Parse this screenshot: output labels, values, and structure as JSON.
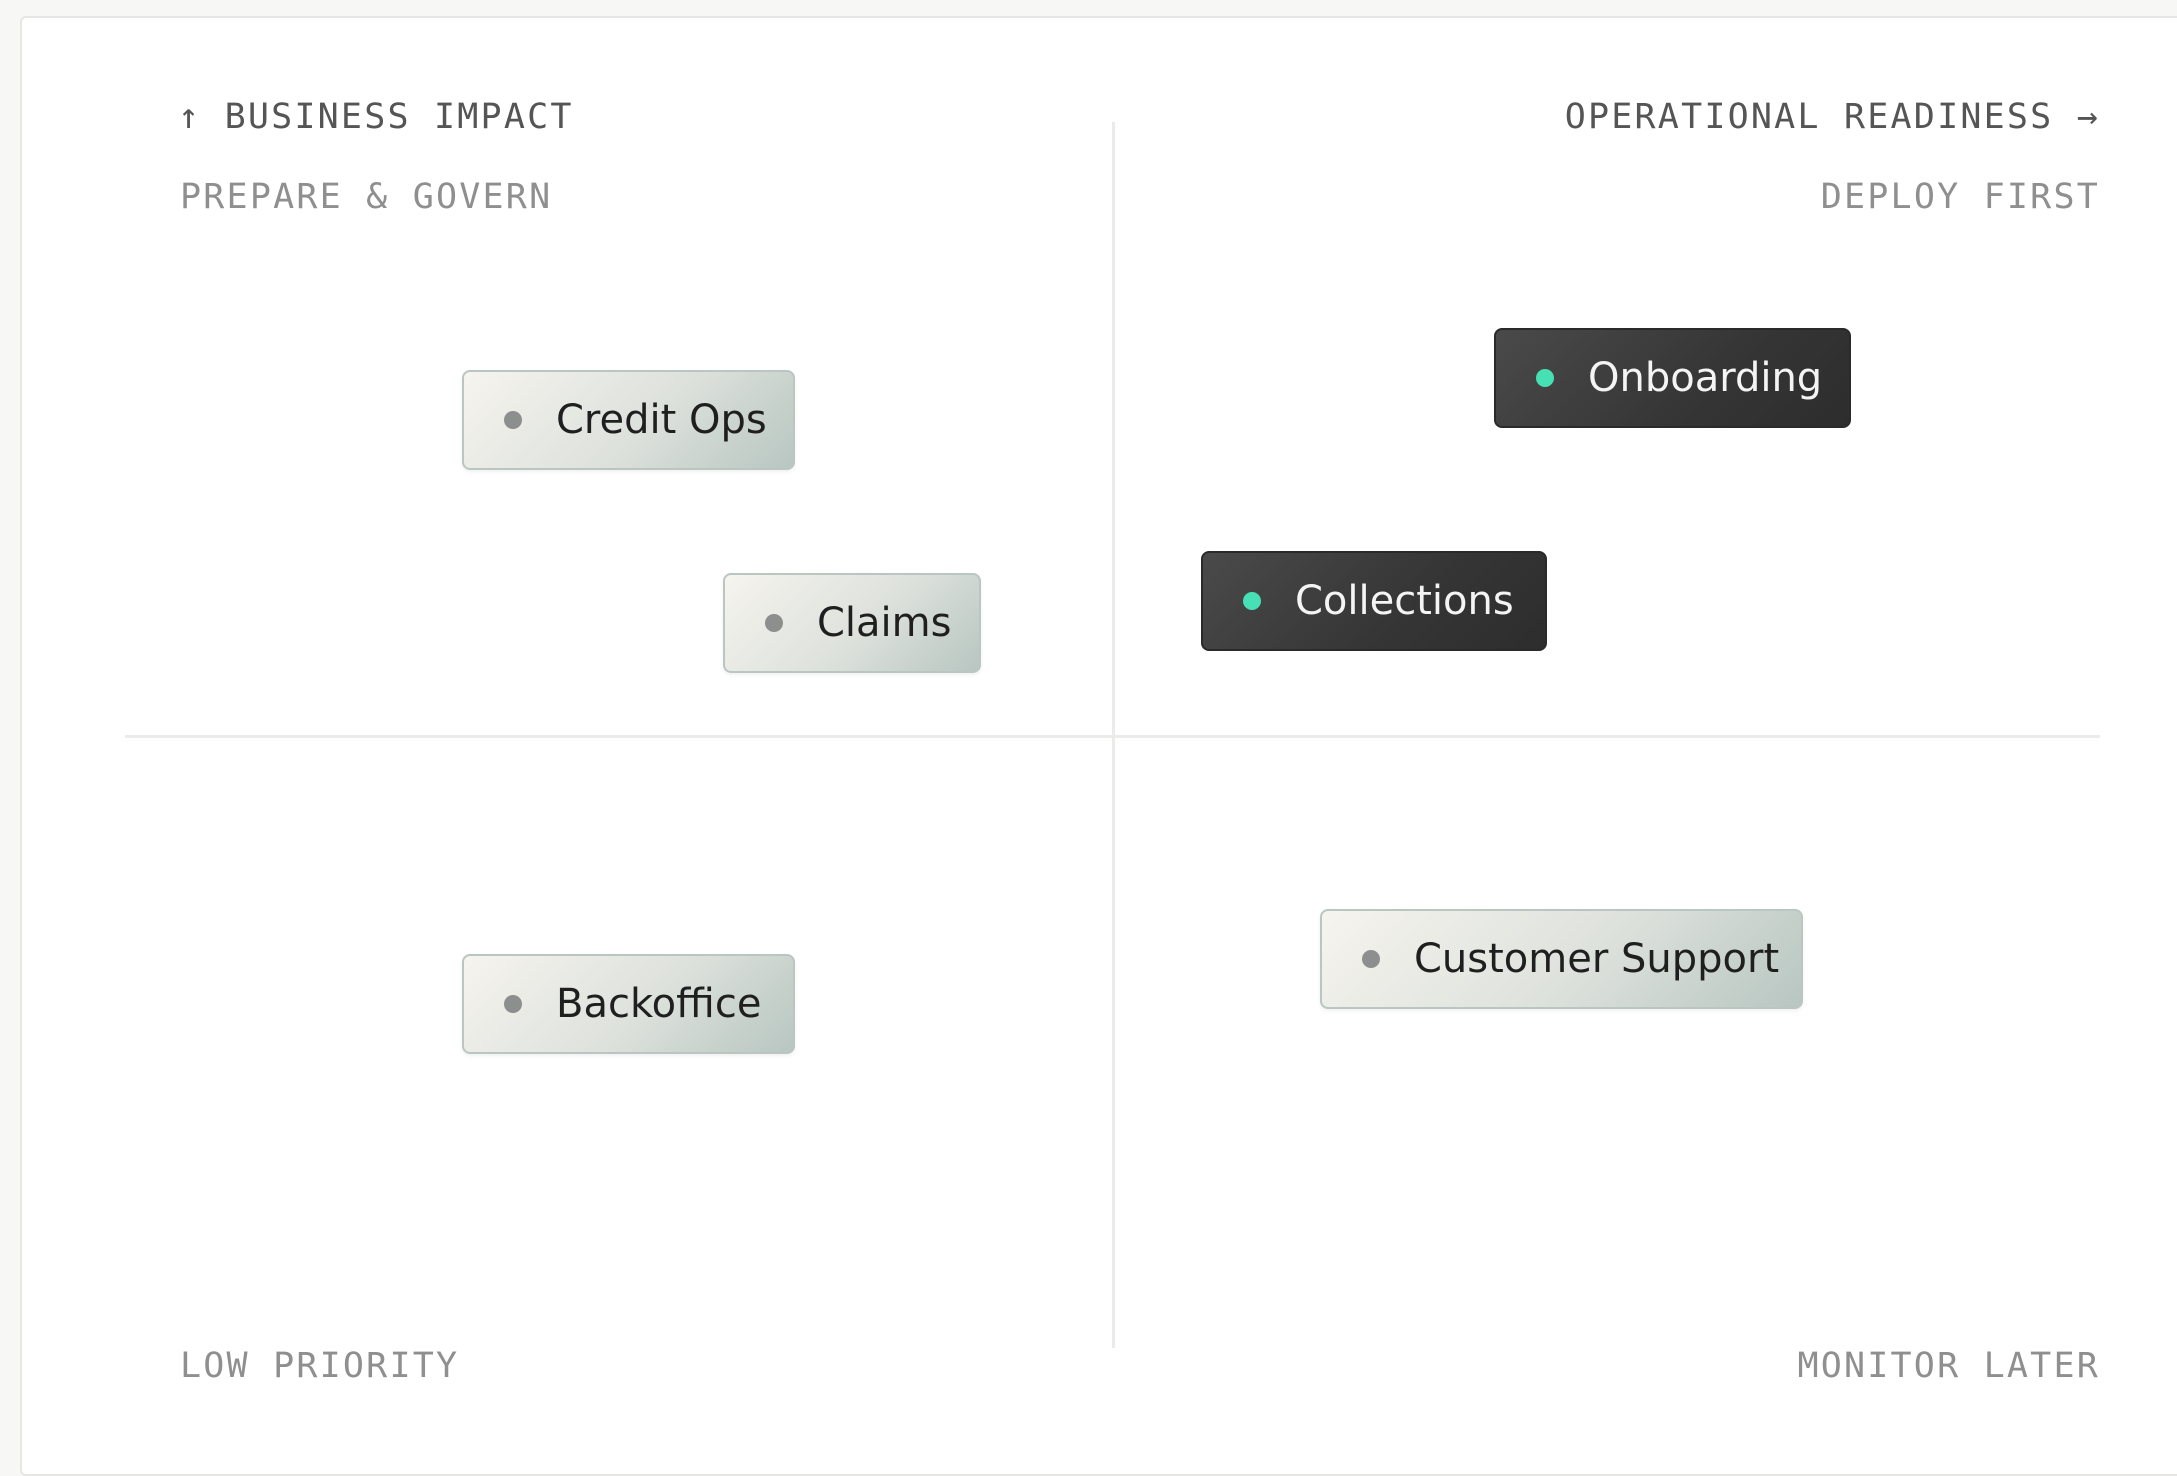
{
  "axes": {
    "y_label": "BUSINESS IMPACT",
    "y_arrow": "↑",
    "x_label": "OPERATIONAL READINESS",
    "x_arrow": "→"
  },
  "quadrants": {
    "top_left": "PREPARE & GOVERN",
    "top_right": "DEPLOY FIRST",
    "bottom_left": "LOW PRIORITY",
    "bottom_right": "MONITOR LATER"
  },
  "items": [
    {
      "label": "Credit Ops",
      "style": "light",
      "dot_color": "#8d8f8e"
    },
    {
      "label": "Claims",
      "style": "light",
      "dot_color": "#8d8f8e"
    },
    {
      "label": "Onboarding",
      "style": "dark",
      "dot_color": "#46e0b4"
    },
    {
      "label": "Collections",
      "style": "dark",
      "dot_color": "#46e0b4"
    },
    {
      "label": "Backoffice",
      "style": "light",
      "dot_color": "#8d8f8e"
    },
    {
      "label": "Customer Support",
      "style": "light",
      "dot_color": "#8d8f8e"
    }
  ],
  "colors": {
    "accent_dot": "#46e0b4",
    "dark_chip": "#353535",
    "light_chip": "#dde1dc",
    "divider": "#ebebea"
  }
}
